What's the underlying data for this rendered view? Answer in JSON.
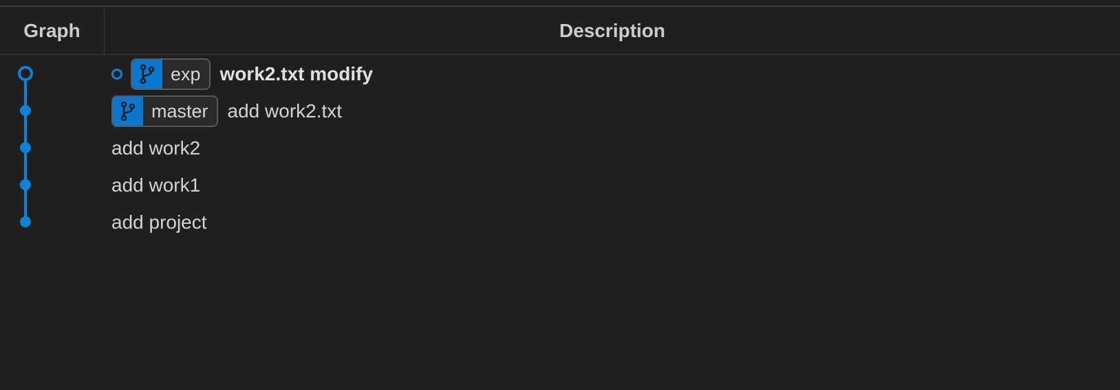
{
  "header": {
    "graph_label": "Graph",
    "description_label": "Description"
  },
  "colors": {
    "graph_line": "#0a84d8",
    "badge_icon_bg": "#0a78d0",
    "background": "#1f1f1f"
  },
  "commits": [
    {
      "message": "work2.txt modify",
      "is_head": true,
      "bold": true,
      "branch": "exp",
      "icon": "git-branch-icon"
    },
    {
      "message": "add work2.txt",
      "is_head": false,
      "bold": false,
      "branch": "master",
      "icon": "git-branch-icon"
    },
    {
      "message": "add work2",
      "is_head": false,
      "bold": false,
      "branch": null
    },
    {
      "message": "add work1",
      "is_head": false,
      "bold": false,
      "branch": null
    },
    {
      "message": "add project",
      "is_head": false,
      "bold": false,
      "branch": null
    }
  ]
}
